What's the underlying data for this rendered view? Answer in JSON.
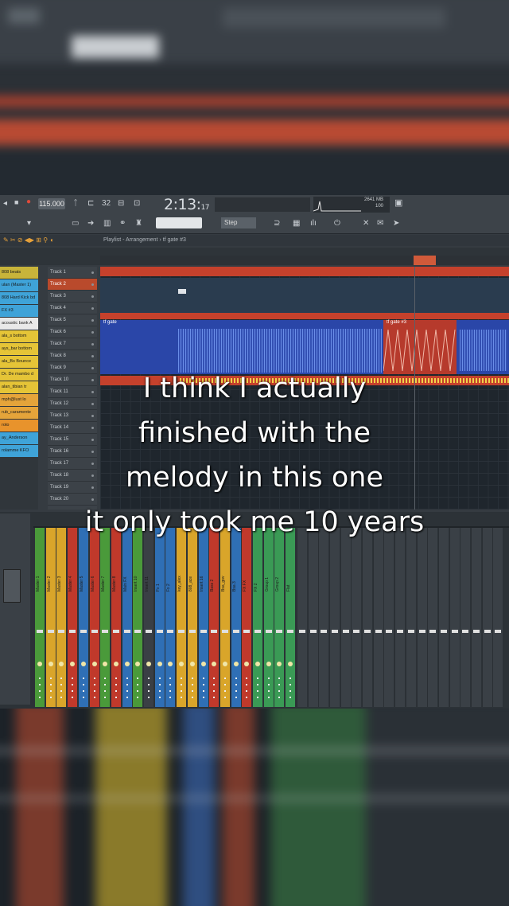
{
  "toolbar": {
    "tempo": "115.000",
    "time": "2:13:",
    "time_ticks": "17",
    "pattern_num": "32",
    "mem_line1": "2641 MB",
    "mem_line2": "100"
  },
  "playlist": {
    "title": "Playlist - Arrangement › tf gate #3"
  },
  "browser_items": [
    {
      "label": "808 beats",
      "color": "#c8b43a"
    },
    {
      "label": "ulan (Master 1)",
      "color": "#3fa3d8"
    },
    {
      "label": "808 Hard Kick bd",
      "color": "#3fa3d8"
    },
    {
      "label": "FX #3",
      "color": "#3fa3d8"
    },
    {
      "label": "acoustic bank A",
      "color": "#e9e9e9"
    },
    {
      "label": "ala_s bottom",
      "color": "#e5c437"
    },
    {
      "label": "ays_bar bottom",
      "color": "#e5c437"
    },
    {
      "label": "ala_Bs Bounce",
      "color": "#e5c437"
    },
    {
      "label": "Dr. De mambo d",
      "color": "#e5c437"
    },
    {
      "label": "alan_tibian tr",
      "color": "#e5c437"
    },
    {
      "label": "mph@lust lo",
      "color": "#e5a43a"
    },
    {
      "label": "rub_caramente",
      "color": "#e5a43a"
    },
    {
      "label": "roto",
      "color": "#e8932c"
    },
    {
      "label": "ay_Anderson",
      "color": "#3fa3d8"
    },
    {
      "label": "rolamme KFO",
      "color": "#3fa3d8"
    }
  ],
  "tracks": [
    {
      "label": "Track 1",
      "selected": false
    },
    {
      "label": "Track 2",
      "selected": true
    },
    {
      "label": "Track 3",
      "selected": false
    },
    {
      "label": "Track 4",
      "selected": false
    },
    {
      "label": "Track 5",
      "selected": false
    },
    {
      "label": "Track 6",
      "selected": false
    },
    {
      "label": "Track 7",
      "selected": false
    },
    {
      "label": "Track 8",
      "selected": false
    },
    {
      "label": "Track 9",
      "selected": false
    },
    {
      "label": "Track 10",
      "selected": false
    },
    {
      "label": "Track 11",
      "selected": false
    },
    {
      "label": "Track 12",
      "selected": false
    },
    {
      "label": "Track 13",
      "selected": false
    },
    {
      "label": "Track 14",
      "selected": false
    },
    {
      "label": "Track 15",
      "selected": false
    },
    {
      "label": "Track 16",
      "selected": false
    },
    {
      "label": "Track 17",
      "selected": false
    },
    {
      "label": "Track 18",
      "selected": false
    },
    {
      "label": "Track 19",
      "selected": false
    },
    {
      "label": "Track 20",
      "selected": false
    }
  ],
  "clips": [
    {
      "label": "tf gate",
      "color": "#2b4fb8"
    },
    {
      "label": "tf gate #3",
      "color": "#c43a2a"
    },
    {
      "label": "tf gate #2",
      "color": "#2b4fb8"
    }
  ],
  "mixer_strips": [
    {
      "label": "Master 1",
      "color": "#4a9a3a"
    },
    {
      "label": "Master 2",
      "color": "#d9a52a"
    },
    {
      "label": "Master 3",
      "color": "#d9a52a"
    },
    {
      "label": "Master 4",
      "color": "#c0392b"
    },
    {
      "label": "Master 5",
      "color": "#2f6fb5"
    },
    {
      "label": "Master 6",
      "color": "#c0392b"
    },
    {
      "label": "Master 7",
      "color": "#4a9a3a"
    },
    {
      "label": "Master 8",
      "color": "#c0392b"
    },
    {
      "label": "Main FX",
      "color": "#2f6fb5"
    },
    {
      "label": "Insert 10",
      "color": "#4a9a3a"
    },
    {
      "label": "Insert 11",
      "color": "#3a3f45"
    },
    {
      "label": "Fx 1",
      "color": "#2f6fb5"
    },
    {
      "label": "Fx 2",
      "color": "#2f6fb5"
    },
    {
      "label": "key_alex",
      "color": "#d9a52a"
    },
    {
      "label": "808_ace",
      "color": "#d9a52a"
    },
    {
      "label": "Insert 16",
      "color": "#2f6fb5"
    },
    {
      "label": "Bass 2",
      "color": "#c0392b"
    },
    {
      "label": "Bsa_gov",
      "color": "#d9a52a"
    },
    {
      "label": "Bsa 3",
      "color": "#2f6fb5"
    },
    {
      "label": "FX FX",
      "color": "#c0392b"
    },
    {
      "label": "FX 2",
      "color": "#3a9a55"
    },
    {
      "label": "Group 1",
      "color": "#3a9a55"
    },
    {
      "label": "Group 2",
      "color": "#3a9a55"
    },
    {
      "label": "Flat",
      "color": "#3a9a55"
    }
  ],
  "caption": {
    "line1": "I think I actually",
    "line2": "finished with the",
    "line3": "melody in this one",
    "line4": "it only took me 10 years"
  }
}
